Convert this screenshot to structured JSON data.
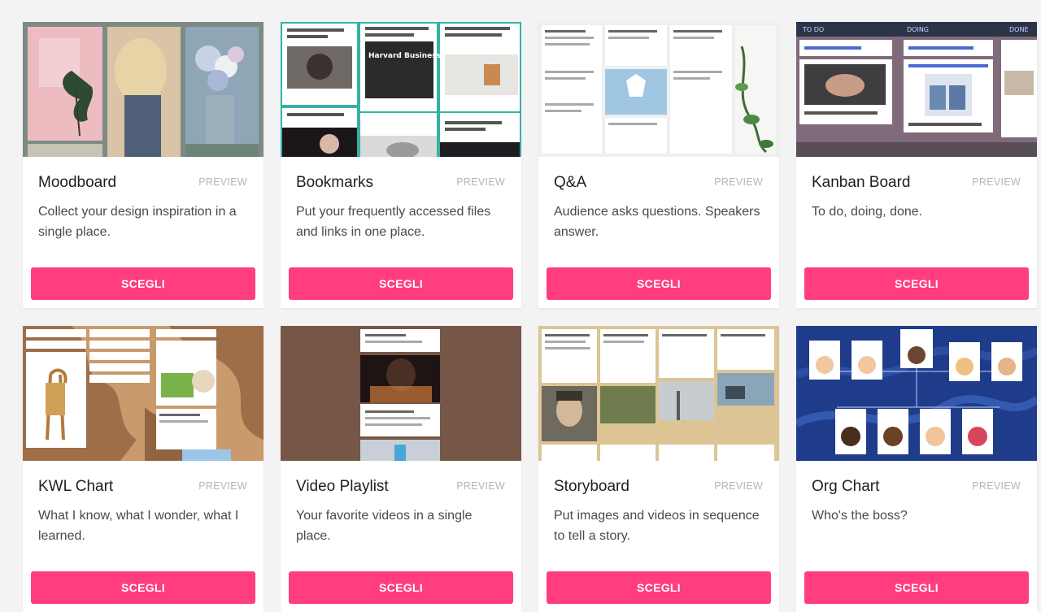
{
  "templates": [
    {
      "title": "Moodboard",
      "preview_label": "PREVIEW",
      "description": "Collect your design inspiration in a single place.",
      "button_label": "SCEGLI",
      "thumbnail": "moodboard-collage"
    },
    {
      "title": "Bookmarks",
      "preview_label": "PREVIEW",
      "description": "Put your frequently accessed files and links in one place.",
      "button_label": "SCEGLI",
      "thumbnail": "bookmarks-grid",
      "thumbnail_text": "Harvard Business Review"
    },
    {
      "title": "Q&A",
      "preview_label": "PREVIEW",
      "description": "Audience asks questions. Speakers answer.",
      "button_label": "SCEGLI",
      "thumbnail": "qa-board"
    },
    {
      "title": "Kanban Board",
      "preview_label": "PREVIEW",
      "description": "To do, doing, done.",
      "button_label": "SCEGLI",
      "thumbnail": "kanban-columns",
      "thumbnail_columns": [
        "TO DO",
        "DOING",
        "DONE"
      ]
    },
    {
      "title": "KWL Chart",
      "preview_label": "PREVIEW",
      "description": "What I know, what I wonder, what I learned.",
      "button_label": "SCEGLI",
      "thumbnail": "kwl-giraffe"
    },
    {
      "title": "Video Playlist",
      "preview_label": "PREVIEW",
      "description": "Your favorite videos in a single place.",
      "button_label": "SCEGLI",
      "thumbnail": "video-playlist"
    },
    {
      "title": "Storyboard",
      "preview_label": "PREVIEW",
      "description": "Put images and videos in sequence to tell a story.",
      "button_label": "SCEGLI",
      "thumbnail": "storyboard-parchment"
    },
    {
      "title": "Org Chart",
      "preview_label": "PREVIEW",
      "description": "Who's the boss?",
      "button_label": "SCEGLI",
      "thumbnail": "org-chart-avatars"
    }
  ],
  "colors": {
    "accent": "#ff3d7f",
    "background": "#f3f3f4",
    "card": "#ffffff",
    "preview_text": "#b5b5b5"
  }
}
